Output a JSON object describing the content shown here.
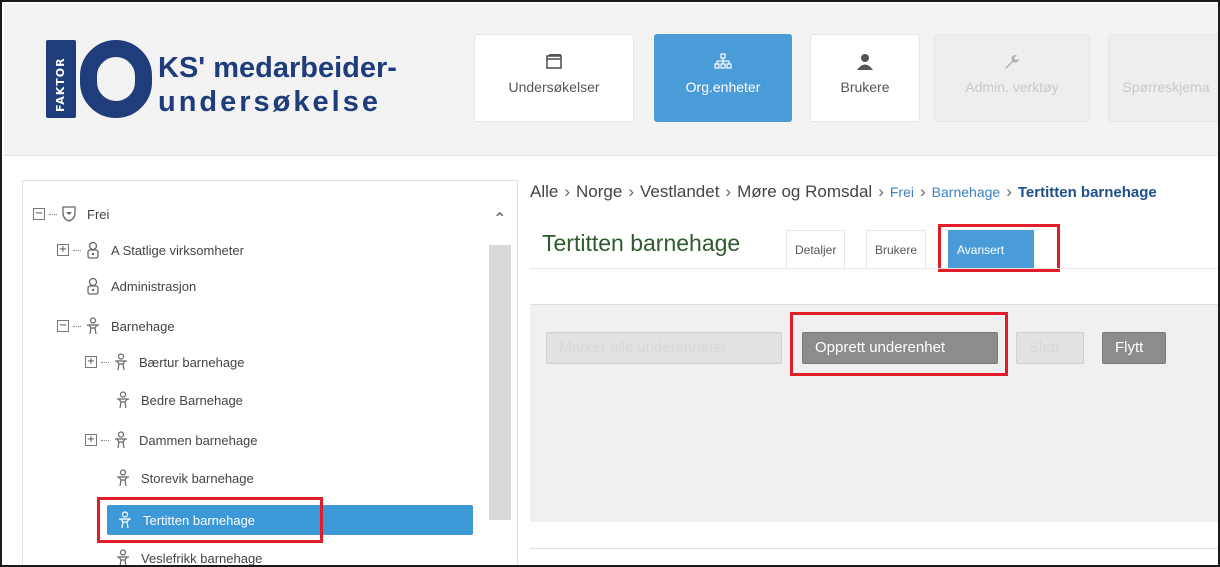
{
  "logo": {
    "faktor": "FAKTOR",
    "line1": "KS' medarbeider-",
    "line2": "undersøkelse",
    "color": "#1f3d7a"
  },
  "nav": [
    {
      "label": "Undersøkelser",
      "icon": "window-icon",
      "state": "normal"
    },
    {
      "label": "Org.enheter",
      "icon": "org-chart-icon",
      "state": "active"
    },
    {
      "label": "Brukere",
      "icon": "user-icon",
      "state": "normal"
    },
    {
      "label": "Admin. verktøy",
      "icon": "wrench-icon",
      "state": "disabled"
    },
    {
      "label": "Spørreskjema",
      "icon": "",
      "state": "disabled"
    }
  ],
  "tree": [
    {
      "label": "Frei",
      "level": 0,
      "expander": "minus",
      "icon": "shield-icon"
    },
    {
      "label": "A Statlige virksomheter",
      "level": 1,
      "expander": "plus",
      "icon": "org-unit-icon"
    },
    {
      "label": "Administrasjon",
      "level": 1,
      "expander": "",
      "icon": "org-unit-icon"
    },
    {
      "label": "Barnehage",
      "level": 1,
      "expander": "minus",
      "icon": "child-icon"
    },
    {
      "label": "Bærtur barnehage",
      "level": 2,
      "expander": "plus",
      "icon": "child-icon"
    },
    {
      "label": "Bedre Barnehage",
      "level": 2,
      "expander": "",
      "icon": "child-icon"
    },
    {
      "label": "Dammen barnehage",
      "level": 2,
      "expander": "plus",
      "icon": "child-icon"
    },
    {
      "label": "Storevik barnehage",
      "level": 2,
      "expander": "",
      "icon": "child-icon"
    },
    {
      "label": "Tertitten barnehage",
      "level": 2,
      "expander": "",
      "icon": "child-icon",
      "selected": true
    },
    {
      "label": "Veslefrikk barnehage",
      "level": 2,
      "expander": "",
      "icon": "child-icon"
    }
  ],
  "breadcrumb": {
    "items": [
      "Alle",
      "Norge",
      "Vestlandet",
      "Møre og Romsdal"
    ],
    "links": [
      "Frei",
      "Barnehage"
    ],
    "current": "Tertitten barnehage"
  },
  "detail": {
    "title": "Tertitten barnehage",
    "tabs": [
      {
        "label": "Detaljer",
        "active": false
      },
      {
        "label": "Brukere",
        "active": false
      },
      {
        "label": "Avansert",
        "active": true
      }
    ]
  },
  "toolbar": {
    "btn1": "Marker alle underenheter",
    "btn2": "Opprett underenhet",
    "btn3": "Slett",
    "btn4": "Flytt"
  },
  "colors": {
    "accent": "#4a9cd9",
    "highlight": "#e01d28",
    "title_green": "#2e5a2e"
  }
}
